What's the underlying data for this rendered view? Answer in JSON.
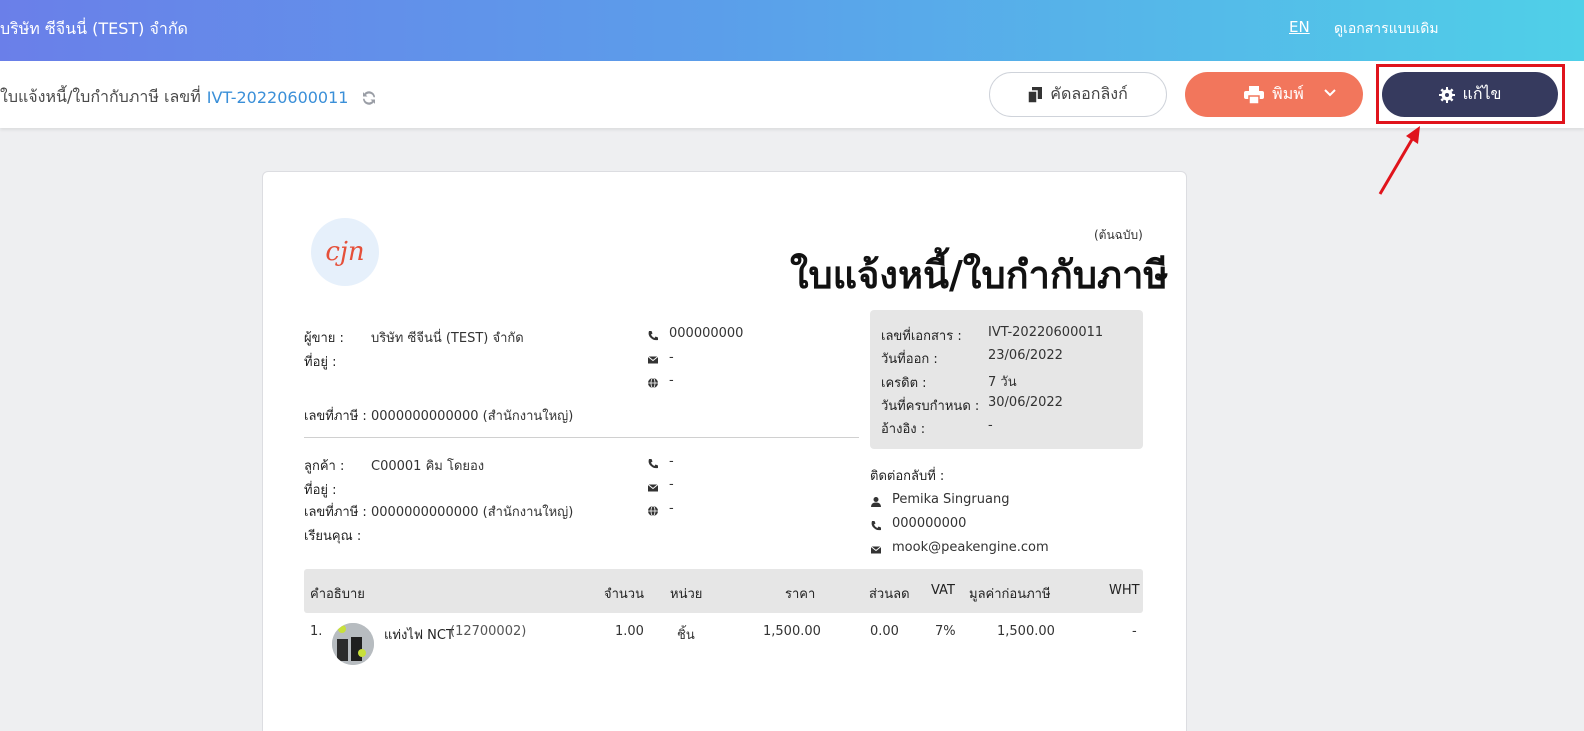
{
  "topbar": {
    "company": "บริษัท ซีจีนนี่ (TEST) จำกัด",
    "lang": "EN",
    "legacy_view": "ดูเอกสารแบบเดิม"
  },
  "subbar": {
    "doc_title": "ใบแจ้งหนี้/ใบกำกับภาษี เลขที่",
    "doc_no": "IVT-20220600011",
    "copy_link": "คัดลอกลิงก์",
    "print": "พิมพ์",
    "edit": "แก้ไข"
  },
  "colors": {
    "accent_blue": "#3a8fd8",
    "print_btn": "#f2765c",
    "edit_btn": "#363a5e",
    "highlight": "#e0141c"
  },
  "paper": {
    "logo_text": "cjn",
    "original_tag": "(ต้นฉบับ)",
    "title": "ใบแจ้งหนี้/ใบกำกับภาษี",
    "seller": {
      "label": "ผู้ขาย :",
      "name": "บริษัท ซีจีนนี่ (TEST) จำกัด",
      "address_label": "ที่อยู่ :",
      "phone": "000000000",
      "email": "-",
      "web": "-",
      "tax_label": "เลขที่ภาษี :",
      "tax_id": "0000000000000 (สำนักงานใหญ่)"
    },
    "customer": {
      "label": "ลูกค้า :",
      "name": "C00001 คิม โดยอง",
      "address_label": "ที่อยู่ :",
      "tax_label": "เลขที่ภาษี :",
      "tax_id": "0000000000000 (สำนักงานใหญ่)",
      "attn_label": "เรียนคุณ :",
      "phone": "-",
      "email": "-",
      "web": "-"
    },
    "info": {
      "doc_no_label": "เลขที่เอกสาร :",
      "doc_no": "IVT-20220600011",
      "issue_label": "วันที่ออก :",
      "issue_date": "23/06/2022",
      "credit_label": "เครดิต :",
      "credit": "7 วัน",
      "due_label": "วันที่ครบกำหนด :",
      "due_date": "30/06/2022",
      "ref_label": "อ้างอิง :",
      "ref": "-"
    },
    "contact": {
      "label": "ติดต่อกลับที่ :",
      "name": "Pemika Singruang",
      "phone": "000000000",
      "email": "mook@peakengine.com"
    },
    "table": {
      "headers": {
        "desc": "คำอธิบาย",
        "qty": "จำนวน",
        "unit": "หน่วย",
        "price": "ราคา",
        "discount": "ส่วนลด",
        "vat": "VAT",
        "pretax": "มูลค่าก่อนภาษี",
        "wht": "WHT"
      },
      "row": {
        "index": "1.",
        "name": "แท่งไฟ NCT",
        "code": "(12700002)",
        "qty": "1.00",
        "unit": "ชิ้น",
        "price": "1,500.00",
        "discount": "0.00",
        "vat": "7%",
        "pretax": "1,500.00",
        "wht": "-"
      }
    }
  }
}
